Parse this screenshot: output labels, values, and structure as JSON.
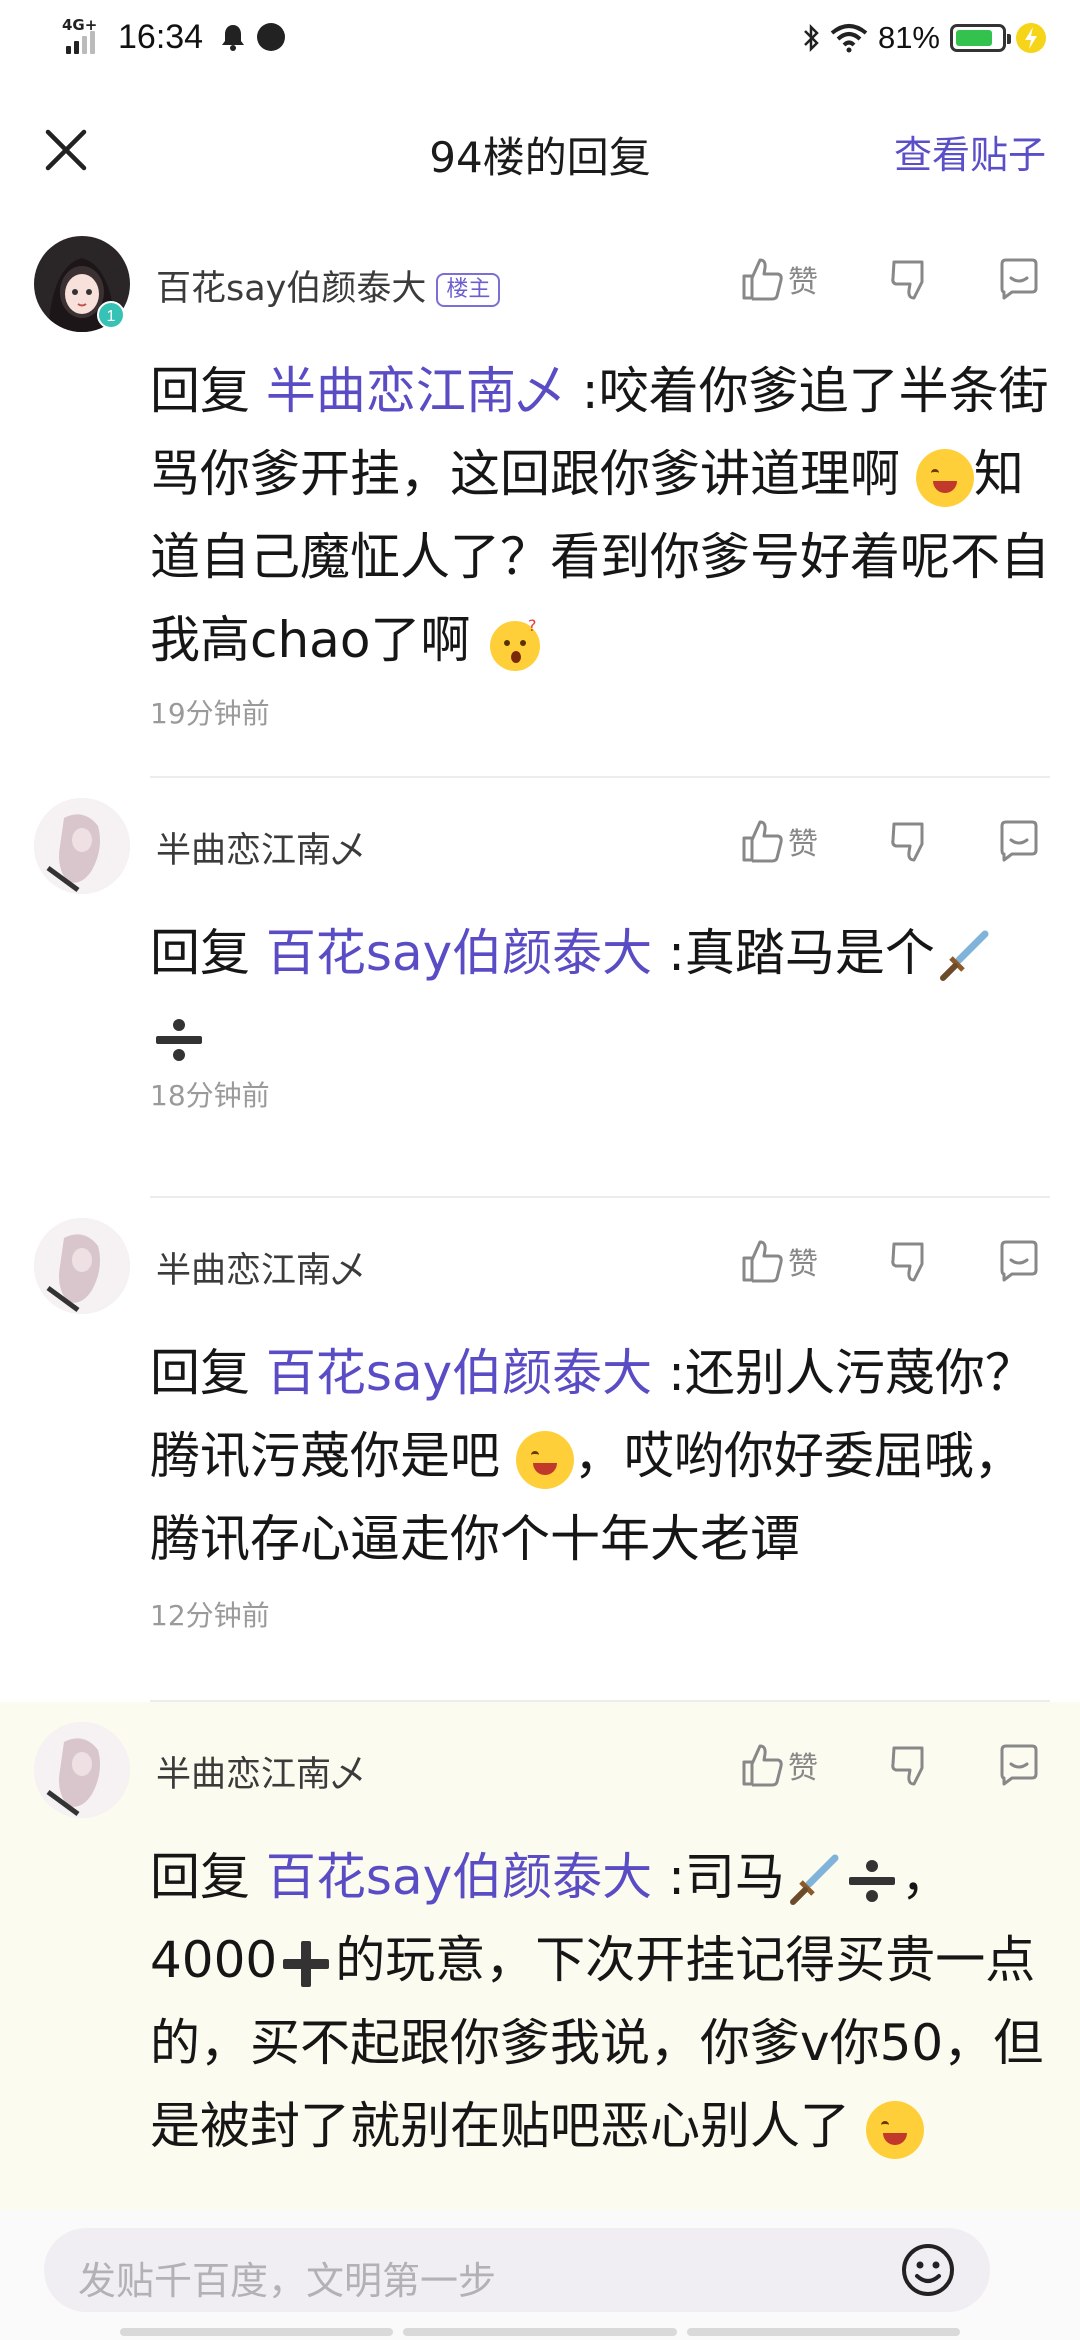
{
  "status_bar": {
    "network": "4G+",
    "time": "16:34",
    "battery_percent": "81%"
  },
  "header": {
    "title": "94楼的回复",
    "action": "查看贴子"
  },
  "comments": [
    {
      "user": "百花say伯颜泰大",
      "badge": "楼主",
      "like_label": "赞",
      "reply_prefix": "回复",
      "mention": "半曲恋江南乄",
      "text_a": " :咬着你爹追了半条街骂你爹开挂，这回跟你爹讲道理啊",
      "text_b": "知道自己魔怔人了？看到你爹号好着呢不自我高chao了啊",
      "time": "19分钟前"
    },
    {
      "user": "半曲恋江南乄",
      "like_label": "赞",
      "reply_prefix": "回复",
      "mention": "百花say伯颜泰大",
      "text_a": " :真踏马是个",
      "time": "18分钟前"
    },
    {
      "user": "半曲恋江南乄",
      "like_label": "赞",
      "reply_prefix": "回复",
      "mention": "百花say伯颜泰大",
      "text_a": " :还别人污蔑你？腾讯污蔑你是吧",
      "text_b": "，哎哟你好委屈哦，腾讯存心逼走你个十年大老谭",
      "time": "12分钟前"
    },
    {
      "user": "半曲恋江南乄",
      "like_label": "赞",
      "reply_prefix": "回复",
      "mention": "百花say伯颜泰大",
      "text_a": " :司马",
      "text_b": "，4000",
      "text_c": "的玩意，下次开挂记得买贵一点的，买不起跟你爹我说，你爹v你50，但是被封了就别在贴吧恶心别人了"
    }
  ],
  "input": {
    "placeholder": "发贴千百度，文明第一步"
  },
  "colors": {
    "accent": "#5b4fc8",
    "highlight_bg": "#fcfbef",
    "battery": "#32c24d"
  }
}
